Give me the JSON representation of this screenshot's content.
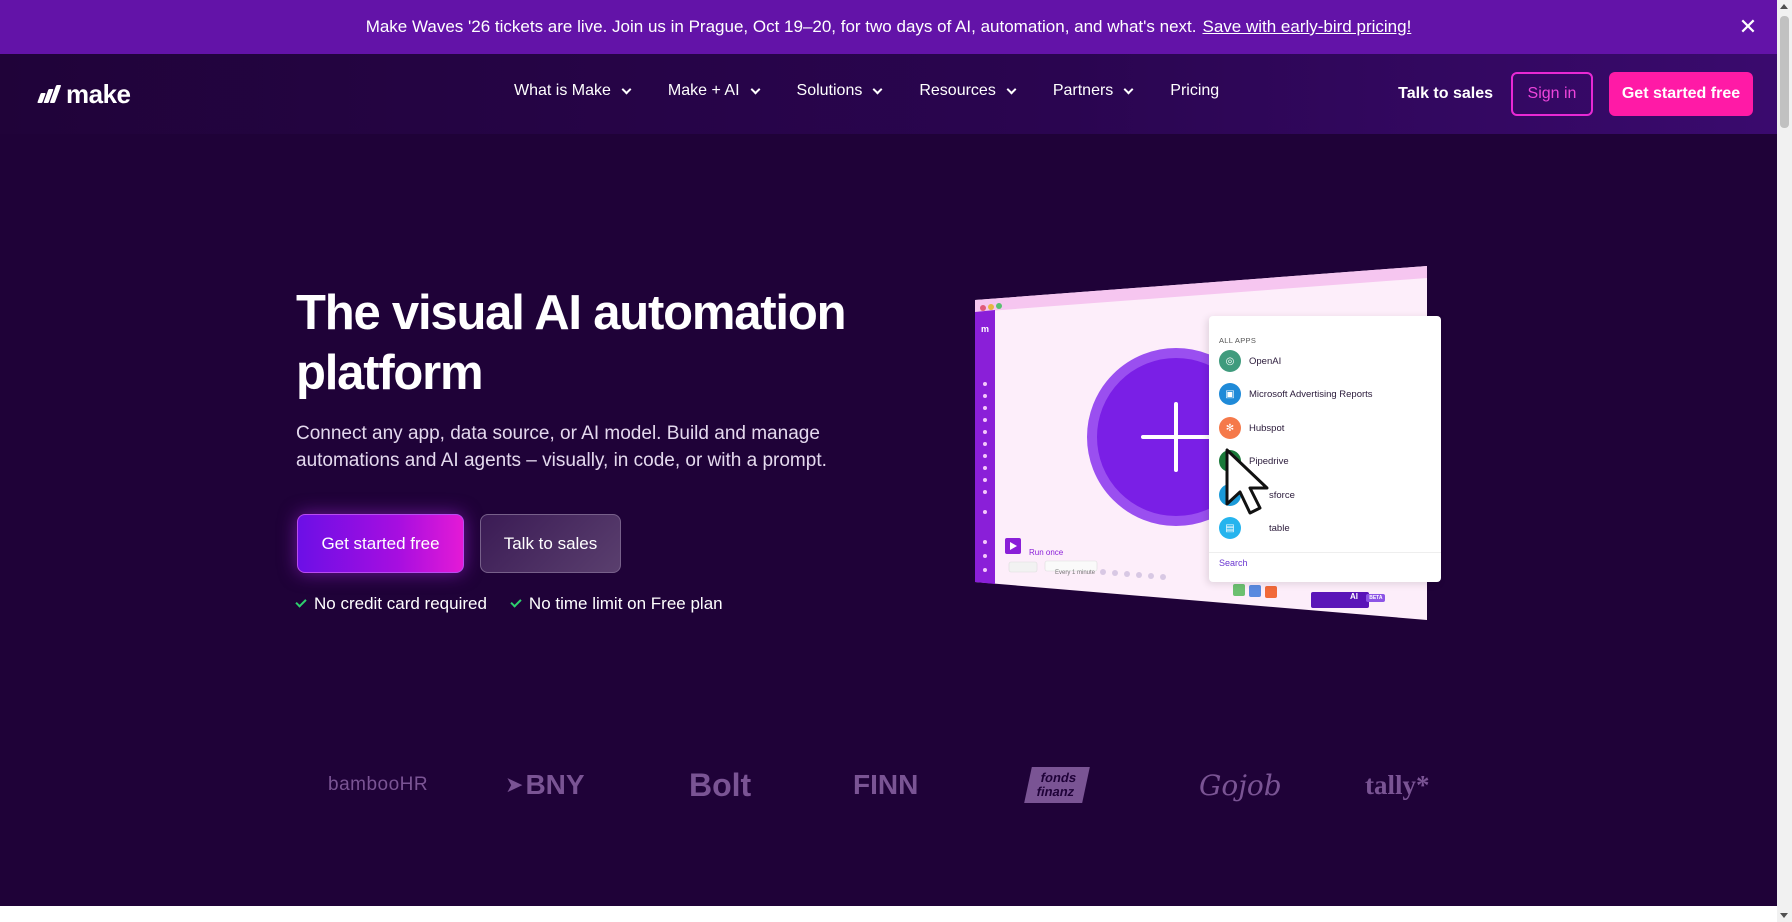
{
  "banner": {
    "text": "Make Waves '26 tickets are live. Join us in Prague, Oct 19–20, for two days of AI, automation, and what's next.",
    "link": "Save with early-bird pricing!",
    "close": "✕"
  },
  "nav": {
    "logo_text": "make",
    "items": [
      {
        "label": "What is Make"
      },
      {
        "label": "Make + AI"
      },
      {
        "label": "Solutions"
      },
      {
        "label": "Resources"
      },
      {
        "label": "Partners"
      },
      {
        "label": "Pricing"
      }
    ],
    "talk_to_sales": "Talk to sales",
    "sign_in": "Sign in",
    "get_started": "Get started free"
  },
  "hero": {
    "title": "The visual AI automation platform",
    "subtitle": "Connect any app, data source, or AI model. Build and manage automations and AI agents – visually, in code, or with a prompt.",
    "primary_cta": "Get started free",
    "secondary_cta": "Talk to sales",
    "checks": [
      "No credit card required",
      "No time limit on Free plan"
    ]
  },
  "illustration": {
    "apps_heading": "ALL APPS",
    "apps": [
      {
        "name": "OpenAI",
        "color": "#3f9b7d",
        "icon": "openai-icon"
      },
      {
        "name": "Microsoft Advertising Reports",
        "color": "#1f8ad8",
        "icon": "microsoft-ads-icon"
      },
      {
        "name": "Hubspot",
        "color": "#f5794a",
        "icon": "hubspot-icon"
      },
      {
        "name": "Pipedrive",
        "color": "#1a7a3a",
        "icon": "pipedrive-icon"
      },
      {
        "name": "sforce",
        "color": "#1b9ad8",
        "icon": "salesforce-icon"
      },
      {
        "name": "table",
        "color": "#25b4ee",
        "icon": "airtable-icon"
      }
    ],
    "search": "Search",
    "run_once": "Run once",
    "schedule": "Every 1 minute",
    "ai_button": "AI",
    "beta": "BETA"
  },
  "logos": [
    "bambooHR",
    "BNY",
    "Bolt",
    "FINN",
    "fonds finanz",
    "Gojob",
    "tally*"
  ],
  "colors": {
    "background": "#1f0238",
    "banner": "#6313a8",
    "accent_pink": "#ff1aa6",
    "accent_purple": "#7a1fe6",
    "check_green": "#2ed06e"
  }
}
